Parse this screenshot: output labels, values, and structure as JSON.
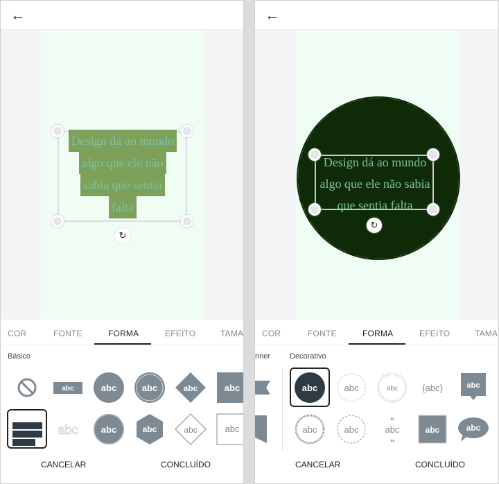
{
  "left": {
    "tabs": [
      "COR",
      "FONTE",
      "FORMA",
      "EFEITO",
      "TAMA"
    ],
    "active_tab": "FORMA",
    "section": "Básico",
    "text_lines": [
      "Design dá ao mundo",
      "algo que ele não",
      "sabia que sentia",
      "falta"
    ],
    "shape_label": "abc",
    "cancel": "CANCELAR",
    "done": "CONCLUÍDO"
  },
  "right": {
    "tabs": [
      "COR",
      "FONTE",
      "FORMA",
      "EFEITO",
      "TAMA"
    ],
    "active_tab": "FORMA",
    "section_prev": "nner",
    "section": "Decorativo",
    "text_lines": [
      "Design dá ao mundo",
      "algo que ele não sabia",
      "que sentia falta"
    ],
    "shape_label": "abc",
    "cancel": "CANCELAR",
    "done": "CONCLUÍDO"
  },
  "colors": {
    "icon": "#7d8a94",
    "icon_dark": "#2e3b45",
    "highlight": "#7da05a",
    "text": "#7ec3a0",
    "circle": "#0e2a06",
    "page": "#effdf5"
  },
  "icons": {
    "back": "arrow-left-icon",
    "rotate": "rotate-icon",
    "none": "no-shape-icon"
  }
}
